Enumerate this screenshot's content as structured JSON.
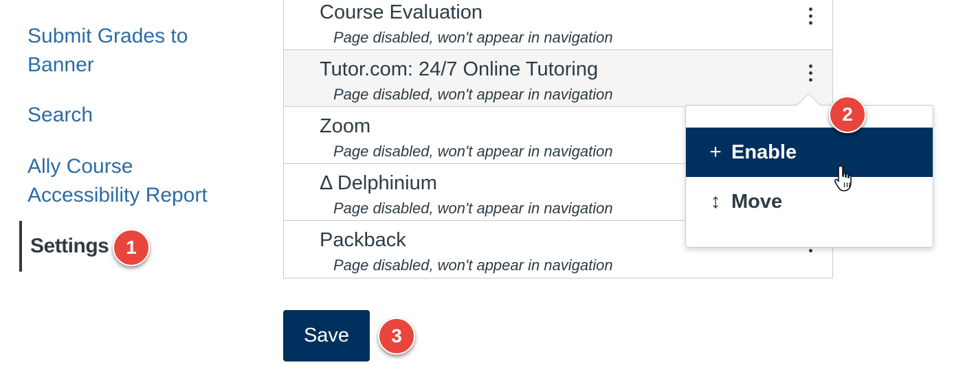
{
  "nav": {
    "items": [
      {
        "line1": "Submit Grades to",
        "line2": "Banner"
      },
      {
        "line1": "Search"
      },
      {
        "line1": "Ally Course",
        "line2": "Accessibility Report"
      }
    ],
    "active": "Settings"
  },
  "pages": [
    {
      "title": "Course Evaluation",
      "status": "Page disabled, won't appear in navigation"
    },
    {
      "title": "Tutor.com: 24/7 Online Tutoring",
      "status": "Page disabled, won't appear in navigation"
    },
    {
      "title": "Zoom",
      "status": "Page disabled, won't appear in navigation"
    },
    {
      "title": "Δ Delphinium",
      "status": "Page disabled, won't appear in navigation"
    },
    {
      "title": "Packback",
      "status": "Page disabled, won't appear in navigation"
    }
  ],
  "menu": {
    "enable_icon": "+",
    "enable_label": "Enable",
    "move_icon": "↕",
    "move_label": "Move"
  },
  "save_label": "Save",
  "callouts": [
    "1",
    "2",
    "3"
  ],
  "colors": {
    "link": "#2d6ba4",
    "primary": "#00305e",
    "text": "#2d3b45",
    "callout": "#e8453c"
  }
}
